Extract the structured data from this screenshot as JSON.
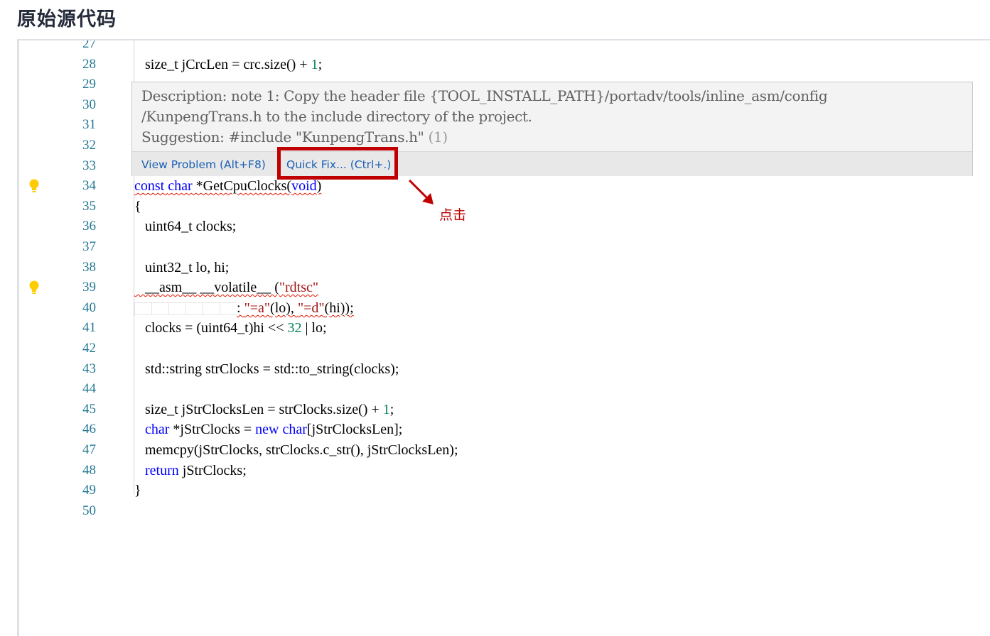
{
  "page": {
    "title": "原始源代码"
  },
  "editor": {
    "lines": [
      {
        "n": "27",
        "tokens": []
      },
      {
        "n": "28",
        "tokens": [
          [
            "t",
            "   size_t jCrcLen = crc.size() + "
          ],
          [
            "num",
            "1"
          ],
          [
            "t",
            ";"
          ]
        ]
      },
      {
        "n": "29",
        "tokens": [
          [
            "t",
            ""
          ]
        ]
      },
      {
        "n": "30",
        "tokens": []
      },
      {
        "n": "31",
        "tokens": []
      },
      {
        "n": "32",
        "tokens": []
      },
      {
        "n": "33",
        "tokens": []
      },
      {
        "n": "34",
        "bulb": true,
        "squiggle": true,
        "tokens": [
          [
            "kw",
            "const"
          ],
          [
            "t",
            " "
          ],
          [
            "kw",
            "char"
          ],
          [
            "t",
            " *GetCpuClocks("
          ],
          [
            "kw",
            "void"
          ],
          [
            "t",
            ")"
          ]
        ]
      },
      {
        "n": "35",
        "tokens": [
          [
            "t",
            "{"
          ]
        ]
      },
      {
        "n": "36",
        "tokens": [
          [
            "t",
            "   uint64_t clocks;"
          ]
        ]
      },
      {
        "n": "37",
        "tokens": []
      },
      {
        "n": "38",
        "tokens": [
          [
            "t",
            "   uint32_t lo, hi;"
          ]
        ]
      },
      {
        "n": "39",
        "bulb": true,
        "squiggle": true,
        "tokens": [
          [
            "t",
            "   __asm__ __volatile__ ("
          ],
          [
            "str",
            "\"rdtsc\""
          ]
        ]
      },
      {
        "n": "40",
        "squiggle": true,
        "ws": 6,
        "tokens": [
          [
            "t",
            ": "
          ],
          [
            "str",
            "\"=a\""
          ],
          [
            "t",
            "(lo), "
          ],
          [
            "str",
            "\"=d\""
          ],
          [
            "t",
            "(hi));"
          ]
        ]
      },
      {
        "n": "41",
        "tokens": [
          [
            "t",
            "   clocks = (uint64_t)hi << "
          ],
          [
            "num",
            "32"
          ],
          [
            "t",
            " | lo;"
          ]
        ]
      },
      {
        "n": "42",
        "tokens": []
      },
      {
        "n": "43",
        "tokens": [
          [
            "t",
            "   std::string strClocks = std::to_string(clocks);"
          ]
        ]
      },
      {
        "n": "44",
        "tokens": []
      },
      {
        "n": "45",
        "tokens": [
          [
            "t",
            "   size_t jStrClocksLen = strClocks.size() + "
          ],
          [
            "num",
            "1"
          ],
          [
            "t",
            ";"
          ]
        ]
      },
      {
        "n": "46",
        "tokens": [
          [
            "t",
            "   "
          ],
          [
            "kw",
            "char"
          ],
          [
            "t",
            " *jStrClocks = "
          ],
          [
            "kw",
            "new"
          ],
          [
            "t",
            " "
          ],
          [
            "kw",
            "char"
          ],
          [
            "t",
            "[jStrClocksLen];"
          ]
        ]
      },
      {
        "n": "47",
        "tokens": [
          [
            "t",
            "   memcpy(jStrClocks, strClocks.c_str(), jStrClocksLen);"
          ]
        ]
      },
      {
        "n": "48",
        "tokens": [
          [
            "t",
            "   "
          ],
          [
            "kw",
            "return"
          ],
          [
            "t",
            " jStrClocks;"
          ]
        ]
      },
      {
        "n": "49",
        "tokens": [
          [
            "t",
            "}"
          ]
        ]
      },
      {
        "n": "50",
        "tokens": []
      }
    ]
  },
  "hover": {
    "description_line1": "Description: note 1: Copy the header file {TOOL_INSTALL_PATH}/portadv/tools/inline_asm/config",
    "description_line2": "/KunpengTrans.h to the include directory of the project.",
    "suggestion": "Suggestion: #include \"KunpengTrans.h\"",
    "count": "(1)",
    "view_problem": "View Problem (Alt+F8)",
    "quick_fix": "Quick Fix... (Ctrl+.)"
  },
  "annotation": {
    "text": "点击",
    "color": "#c00000"
  }
}
